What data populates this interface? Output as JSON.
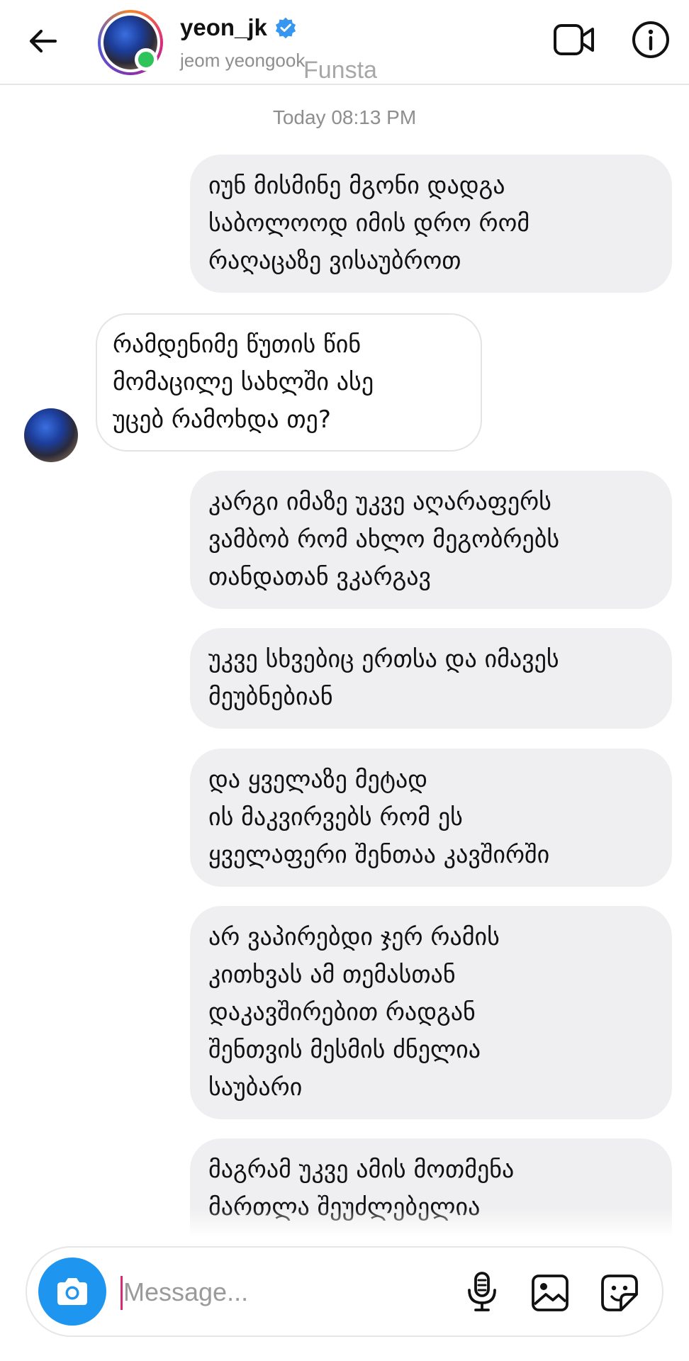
{
  "header": {
    "username": "yeon_jk",
    "full_name": "jeom yeongook",
    "overlay_label": "Funsta",
    "icons": {
      "back": "arrow-left-icon",
      "verified": "verified-badge-icon",
      "video": "video-call-icon",
      "info": "info-icon"
    },
    "online": true
  },
  "conversation": {
    "timestamp": "Today 08:13 PM",
    "messages": [
      {
        "direction": "sent",
        "lines": [
          "იუნ მისმინე მგონი დადგა",
          "საბოლოოდ იმის დრო რომ",
          "რაღაცაზე ვისაუბროთ"
        ]
      },
      {
        "direction": "received",
        "lines": [
          "რამდენიმე წუთის წინ",
          "მომაცილე სახლში ასე",
          "უცებ რამოხდა თე?"
        ]
      },
      {
        "direction": "sent",
        "lines": [
          "კარგი იმაზე უკვე აღარაფერს",
          "ვამბობ რომ ახლო მეგობრებს",
          "თანდათან ვკარგავ"
        ]
      },
      {
        "direction": "sent",
        "lines": [
          "უკვე სხვებიც ერთსა და იმავეს",
          "მეუბნებიან"
        ]
      },
      {
        "direction": "sent",
        "lines": [
          "და ყველაზე მეტად",
          "ის მაკვირვებს რომ ეს",
          "ყველაფერი შენთაა კავშირში"
        ]
      },
      {
        "direction": "sent",
        "lines": [
          "არ ვაპირებდი ჯერ რამის",
          "კითხვას ამ თემასთან",
          "დაკავშირებით რადგან",
          "შენთვის მესმის ძნელია",
          "საუბარი"
        ]
      },
      {
        "direction": "sent",
        "lines": [
          "მაგრამ უკვე ამის მოთმენა",
          "მართლა შეუძლებელია"
        ]
      }
    ]
  },
  "composer": {
    "placeholder": "Message...",
    "value": "",
    "icons": {
      "camera": "camera-icon",
      "mic": "microphone-icon",
      "gallery": "image-gallery-icon",
      "sticker": "sticker-icon"
    },
    "accent_color": "#1e96f0"
  },
  "colors": {
    "sent_bubble": "#efeff1",
    "received_bubble_border": "#e4e4e4",
    "online_dot": "#2ec45a",
    "verified": "#3797f0",
    "caret": "#d62976"
  }
}
